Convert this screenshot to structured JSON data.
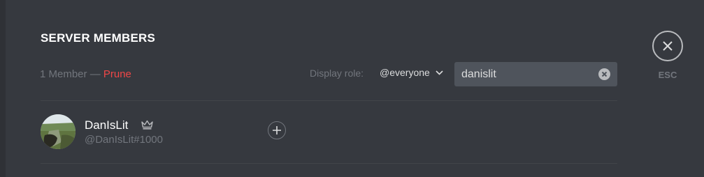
{
  "header": {
    "title": "SERVER MEMBERS",
    "member_count": "1 Member",
    "separator": " — ",
    "prune_label": "Prune"
  },
  "filters": {
    "display_role_label": "Display role:",
    "selected_role": "@everyone",
    "search_value": "danislit"
  },
  "members": [
    {
      "name": "DanIsLit",
      "tag": "@DanIsLit#1000",
      "is_owner": true
    }
  ],
  "close": {
    "esc_label": "ESC"
  },
  "colors": {
    "background": "#36393f",
    "prune": "#f04747",
    "muted_text": "#72767d",
    "search_bg": "#4f545c"
  },
  "icons": {
    "dropdown": "chevron-down-icon",
    "clear": "clear-search-icon",
    "owner": "crown-icon",
    "add_role": "plus-icon",
    "close": "close-icon"
  }
}
